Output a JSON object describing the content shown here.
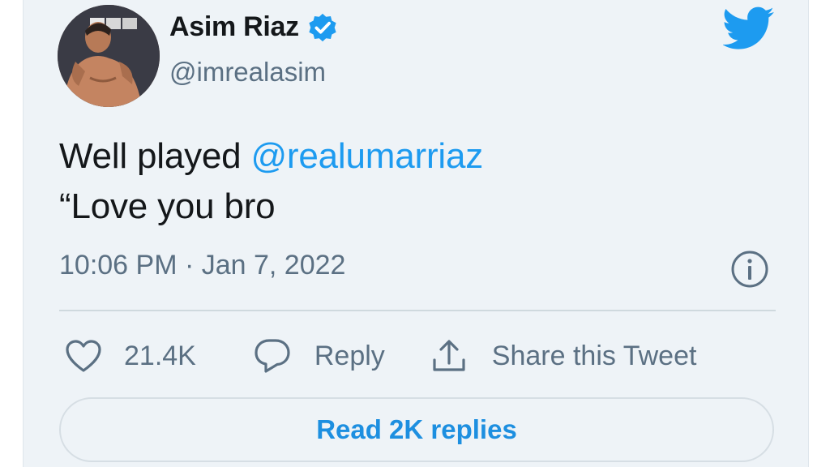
{
  "author": {
    "display_name": "Asim Riaz",
    "handle": "@imrealasim",
    "verified": true,
    "avatar": "profile-photo"
  },
  "tweet": {
    "text_prefix": "Well played ",
    "mention": "@realumarriaz",
    "line2": "“Love you bro",
    "timestamp": "10:06 PM · Jan 7, 2022"
  },
  "actions": {
    "likes": "21.4K",
    "reply_label": "Reply",
    "share_label": "Share this Tweet"
  },
  "read_replies_label": "Read 2K replies",
  "icons": {
    "brand": "twitter-bird-icon",
    "verified": "verified-badge-icon",
    "info": "info-icon",
    "like": "heart-icon",
    "reply": "reply-bubble-icon",
    "share": "share-icon"
  },
  "colors": {
    "accent": "#1d9bf0",
    "background": "#eef3f7",
    "text": "#14171a",
    "secondary_text": "#5b7083"
  }
}
